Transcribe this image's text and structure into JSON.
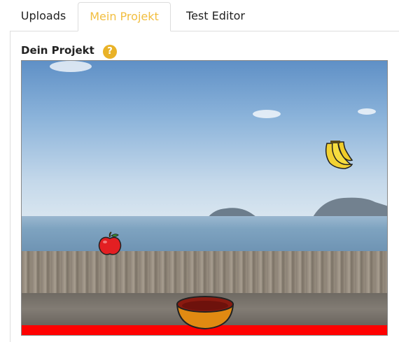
{
  "tabs": [
    {
      "label": "Uploads",
      "active": false
    },
    {
      "label": "Mein Projekt",
      "active": true
    },
    {
      "label": "Test Editor",
      "active": false
    }
  ],
  "project": {
    "heading": "Dein Projekt",
    "help_symbol": "?"
  },
  "stage": {
    "sprites": [
      "banana",
      "apple",
      "bowl"
    ],
    "floor_color": "#ff0000"
  },
  "colors": {
    "active_tab": "#f2be3f",
    "help_icon": "#e9b227"
  }
}
